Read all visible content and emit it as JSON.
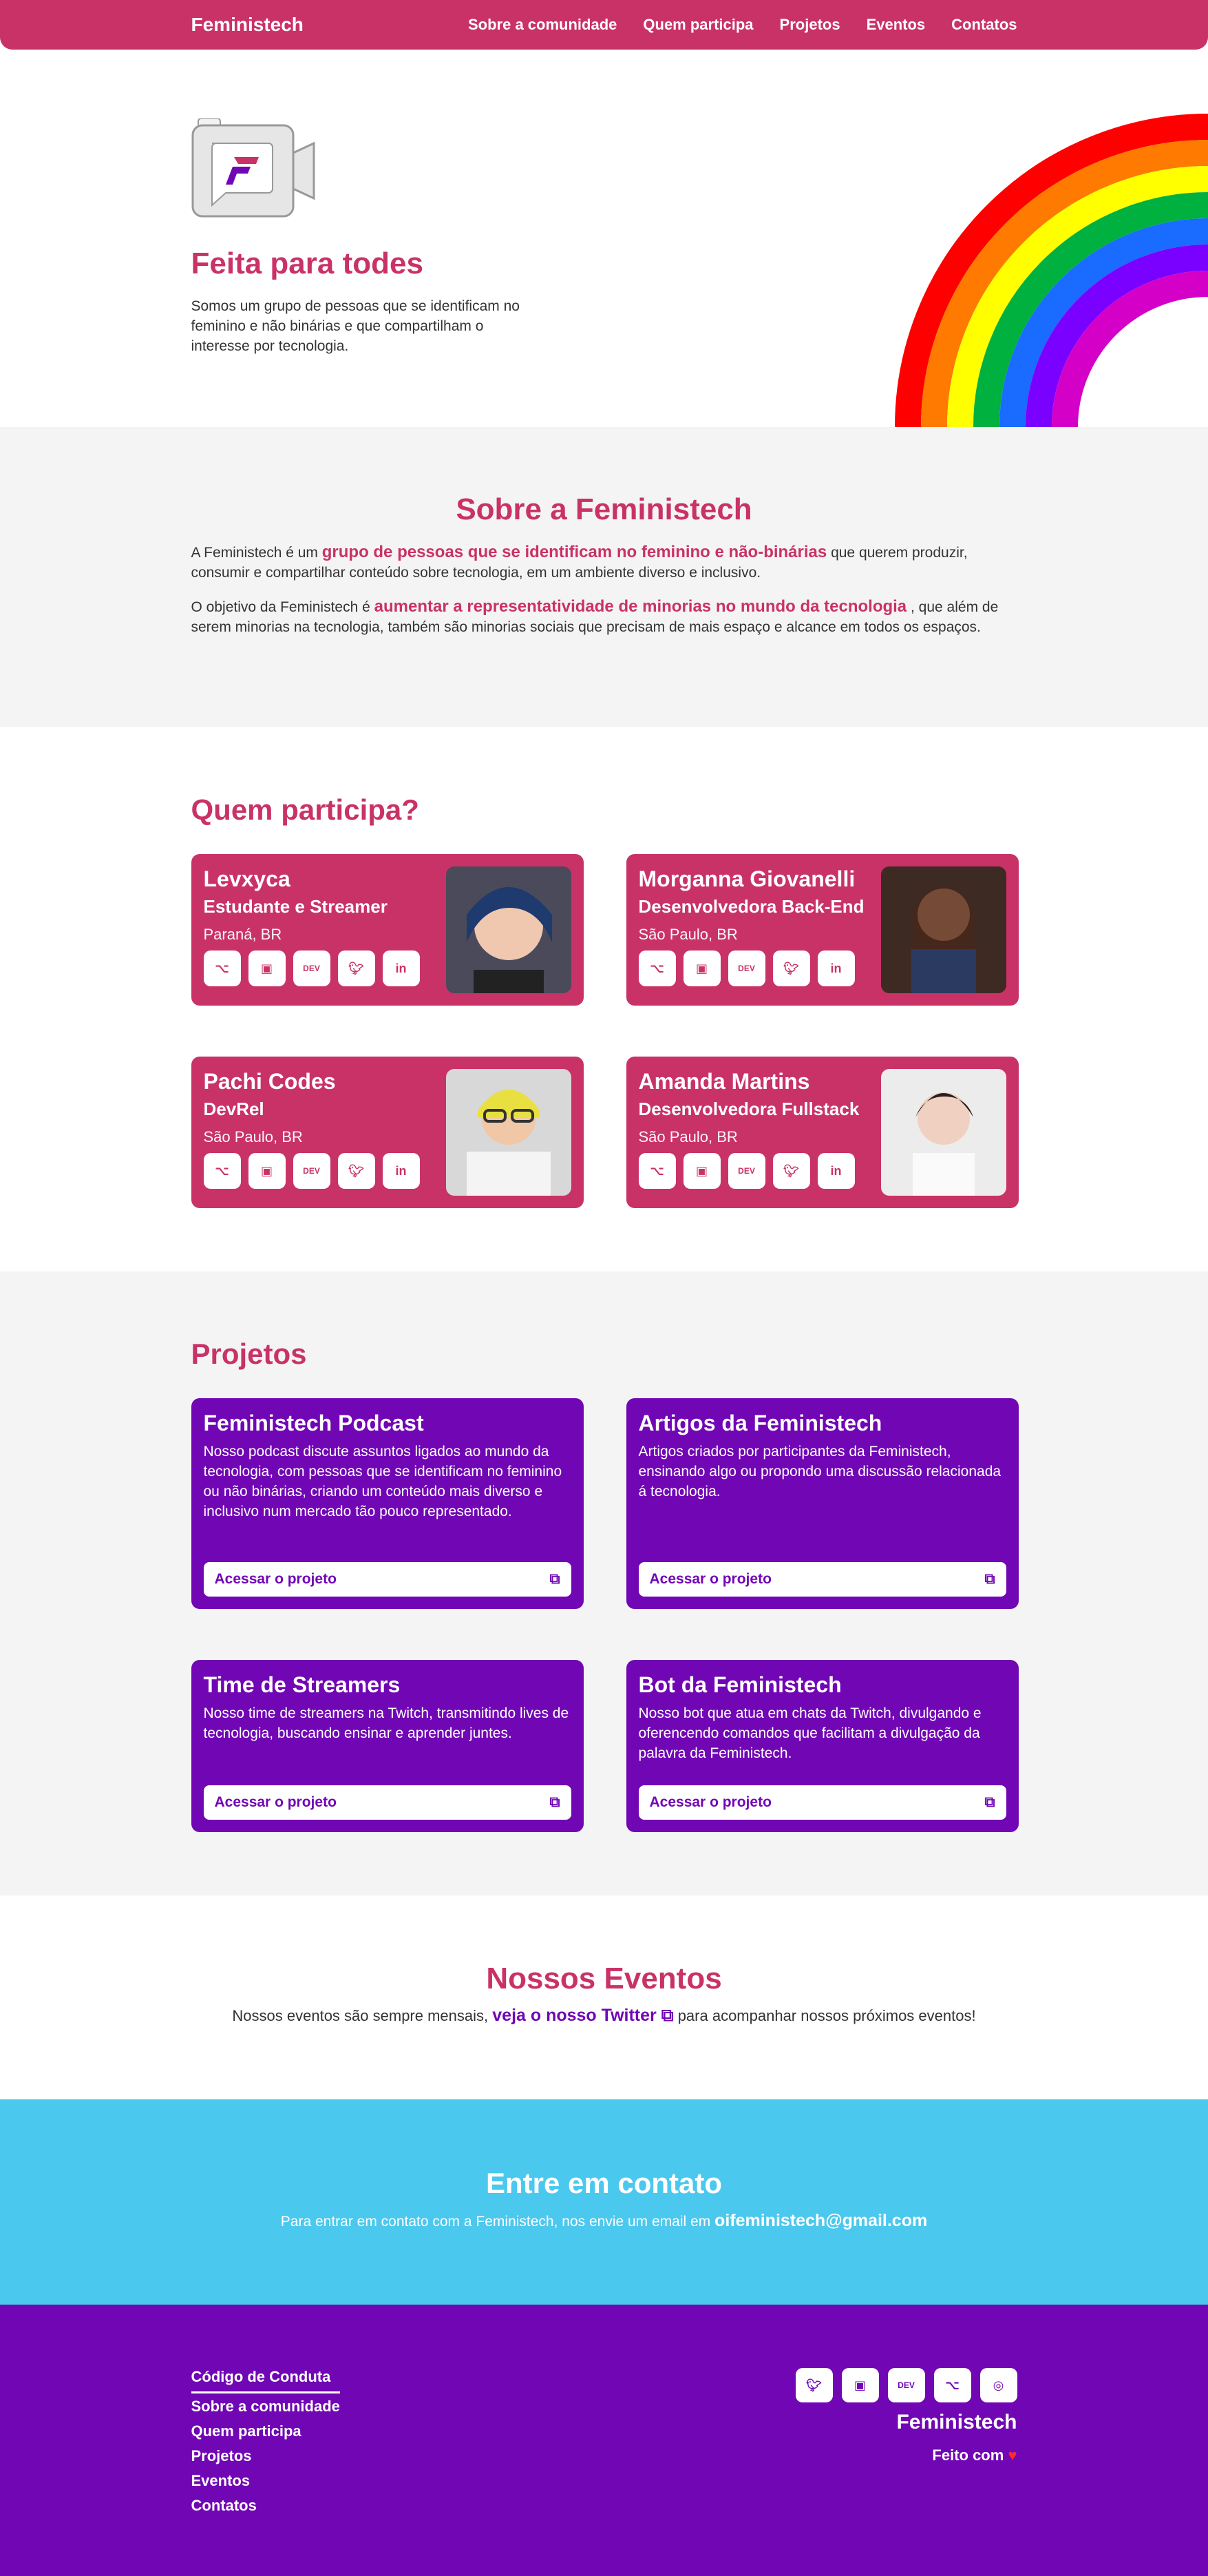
{
  "nav": {
    "brand": "Feministech",
    "links": [
      "Sobre a comunidade",
      "Quem participa",
      "Projetos",
      "Eventos",
      "Contatos"
    ]
  },
  "hero": {
    "title": "Feita para todes",
    "text": "Somos um grupo de pessoas que se identificam no feminino e não binárias e que compartilham o interesse por tecnologia."
  },
  "about": {
    "title": "Sobre a Feministech",
    "p1_before": "A Feministech é um",
    "p1_highlight": "grupo de pessoas que se identificam no feminino e não-binárias",
    "p1_after": "que querem produzir, consumir e compartilhar conteúdo sobre tecnologia, em um ambiente diverso e inclusivo.",
    "p2_before": "O objetivo da Feministech é",
    "p2_highlight": "aumentar a representatividade de minorias no mundo da tecnologia",
    "p2_after": ", que além de serem minorias na tecnologia, também são minorias sociais que precisam de mais espaço e alcance em todos os espaços."
  },
  "people": {
    "title": "Quem participa?",
    "items": [
      {
        "name": "Levxyca",
        "role": "Estudante e Streamer",
        "location": "Paraná, BR"
      },
      {
        "name": "Morganna Giovanelli",
        "role": "Desenvolvedora Back-End",
        "location": "São Paulo, BR"
      },
      {
        "name": "Pachi Codes",
        "role": "DevRel",
        "location": "São Paulo, BR"
      },
      {
        "name": "Amanda Martins",
        "role": "Desenvolvedora Fullstack",
        "location": "São Paulo, BR"
      }
    ],
    "social_icons": [
      "github-icon",
      "twitch-icon",
      "dev-icon",
      "twitter-icon",
      "linkedin-icon"
    ]
  },
  "projects": {
    "title": "Projetos",
    "button_label": "Acessar o projeto",
    "items": [
      {
        "title": "Feministech Podcast",
        "desc": "Nosso podcast discute assuntos ligados ao mundo da tecnologia, com pessoas que se identificam no feminino ou não binárias, criando um conteúdo mais diverso e inclusivo num mercado tão pouco representado."
      },
      {
        "title": "Artigos da Feministech",
        "desc": "Artigos criados por participantes da Feministech, ensinando algo ou propondo uma discussão relacionada á tecnologia."
      },
      {
        "title": "Time de Streamers",
        "desc": "Nosso time de streamers na Twitch, transmitindo lives de tecnologia, buscando ensinar e aprender juntes."
      },
      {
        "title": "Bot da Feministech",
        "desc": "Nosso bot que atua em chats da Twitch, divulgando e oferencendo comandos que facilitam a divulgação da palavra da Feministech."
      }
    ]
  },
  "events": {
    "title": "Nossos Eventos",
    "before": "Nossos eventos são sempre mensais,",
    "link": "veja o nosso Twitter",
    "after": "para acompanhar nossos próximos eventos!"
  },
  "contact": {
    "title": "Entre em contato",
    "text": "Para entrar em contato com a Feministech, nos envie um email em",
    "email": "oifeministech@gmail.com"
  },
  "footer": {
    "links": [
      "Código de Conduta",
      "Sobre a comunidade",
      "Quem participa",
      "Projetos",
      "Eventos",
      "Contatos"
    ],
    "social_icons": [
      "twitter-icon",
      "twitch-icon",
      "dev-icon",
      "github-icon",
      "instagram-icon"
    ],
    "brand": "Feministech",
    "made_with": "Feito com"
  },
  "colors": {
    "primary": "#c93267",
    "purple": "#7106b5",
    "cyan": "#4bc8ee",
    "gray": "#f4f4f4"
  }
}
